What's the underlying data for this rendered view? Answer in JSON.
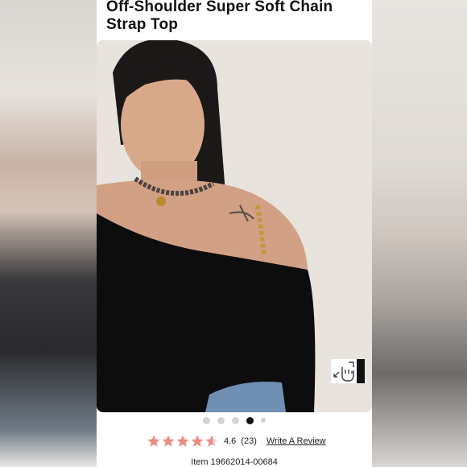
{
  "product": {
    "title": "Off-Shoulder Super Soft Chain Strap Top",
    "image_alt": "Model wearing black off-shoulder top with gold chain strap"
  },
  "carousel": {
    "total_slides": 5,
    "active_index": 3
  },
  "rating": {
    "score": "4.6",
    "score_value": 4.6,
    "count": "(23)",
    "write_review_label": "Write A Review",
    "star_color": "#e98e81"
  },
  "item": {
    "label": "Item 19662014-00684"
  },
  "icons": {
    "zoom": "hand-pinch-zoom-icon"
  }
}
